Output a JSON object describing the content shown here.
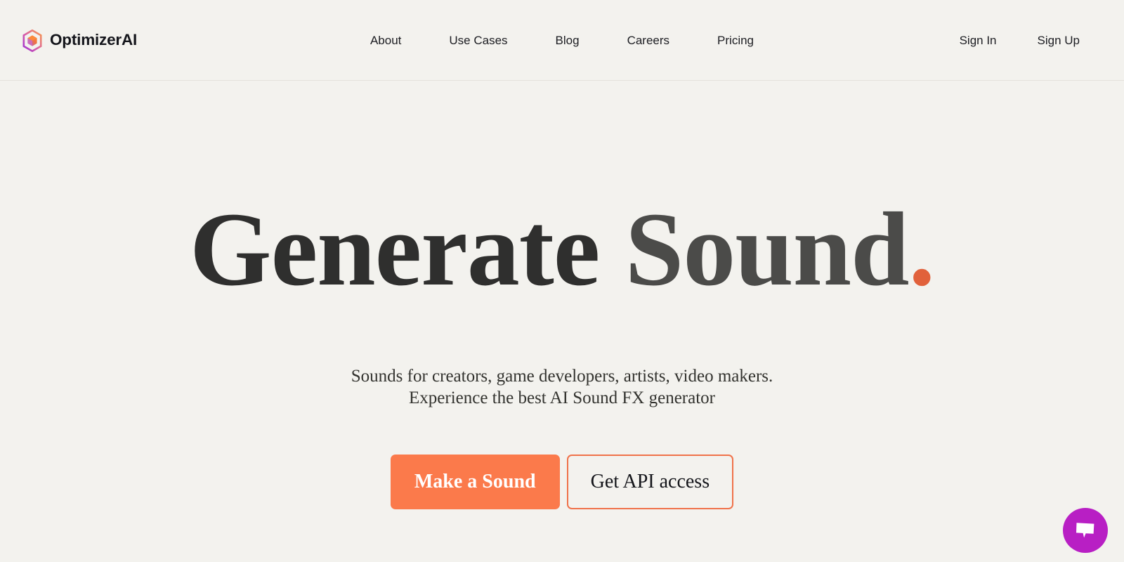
{
  "brand": {
    "name": "OptimizerAI",
    "icon": "hexagon-cube-logo-icon"
  },
  "nav": {
    "items": [
      {
        "label": "About"
      },
      {
        "label": "Use Cases"
      },
      {
        "label": "Blog"
      },
      {
        "label": "Careers"
      },
      {
        "label": "Pricing"
      }
    ]
  },
  "auth": {
    "sign_in": "Sign In",
    "sign_up": "Sign Up"
  },
  "hero": {
    "headline_lead": "Generate",
    "headline_space": " ",
    "headline_tail": "Sound",
    "headline_dot": ".",
    "subtitle_line1": "Sounds for creators, game developers, artists, video makers.",
    "subtitle_line2": "Experience the best AI Sound FX generator",
    "primary_cta": "Make a Sound",
    "secondary_cta": "Get API access"
  },
  "chat": {
    "icon": "chat-bubble-icon"
  },
  "colors": {
    "page_background": "#f3f2ee",
    "header_border": "#e4e2dc",
    "accent_orange": "#fb7a4b",
    "accent_dot": "#e1613b",
    "secondary_border": "#f0724a",
    "headline_dark": "#2f2f2e",
    "headline_gray": "#4b4b49",
    "chat_purple": "#b81fc4",
    "text_dark": "#1c1d22"
  }
}
